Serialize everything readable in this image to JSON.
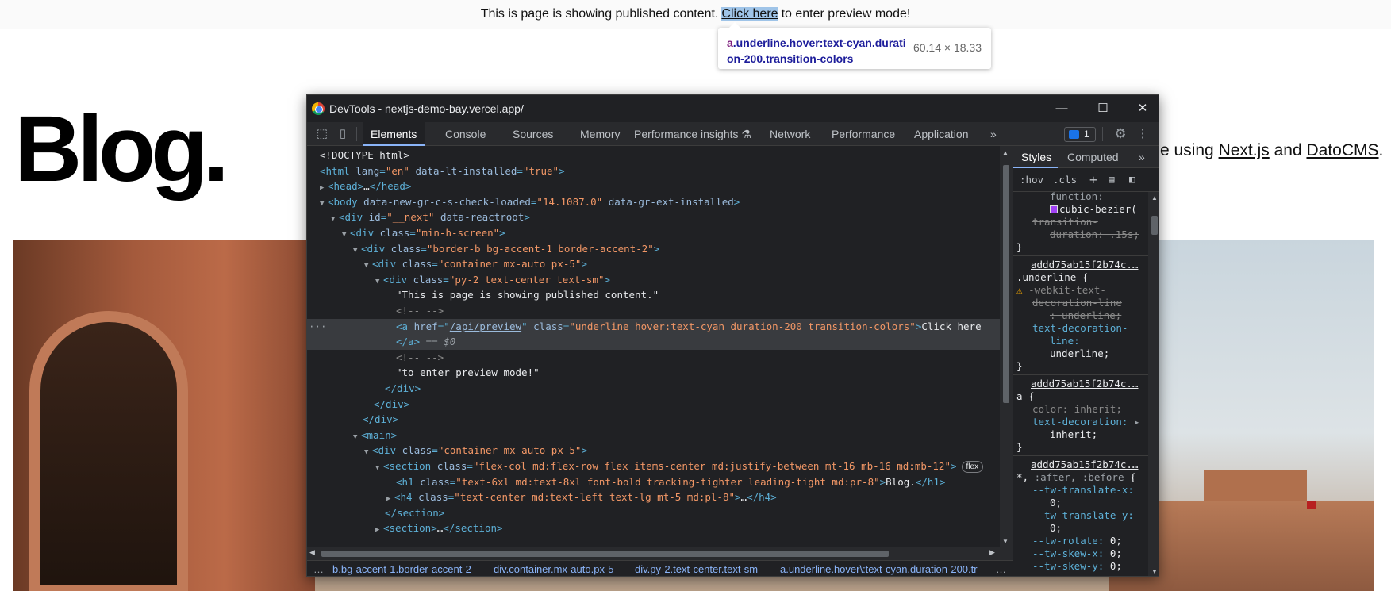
{
  "banner": {
    "text_before": "This is page is showing published content.",
    "link": "Click here",
    "text_after": "to enter preview mode!"
  },
  "tooltip": {
    "tag": "a",
    "classes": ".underline.hover:text-cyan.duration-200.transition-colors",
    "size": "60.14 × 18.33"
  },
  "blog": {
    "title": "Blog.",
    "subtitle_prefix": "e using",
    "link_nextjs": "Next.js",
    "and": "and",
    "link_datocms": "DatoCMS",
    "period": "."
  },
  "devtools": {
    "window_title": "DevTools - nextjs-demo-bay.vercel.app/",
    "win_minimize": "—",
    "win_maximize": "☐",
    "win_close": "✕",
    "tabs": [
      "Elements",
      "Console",
      "Sources",
      "Memory",
      "Performance insights",
      "Network",
      "Performance",
      "Application"
    ],
    "more_tabs": "»",
    "issues_count": "1",
    "dom": {
      "l0": "<!DOCTYPE html>",
      "l1_tag": "html",
      "l1_a1": "lang",
      "l1_v1": "\"en\"",
      "l1_a2": "data-lt-installed",
      "l1_v2": "\"true\"",
      "l2_open": "<head>",
      "l2_ell": "…",
      "l2_close": "</head>",
      "l3_tag": "body",
      "l3_a1": "data-new-gr-c-s-check-loaded",
      "l3_v1": "\"14.1087.0\"",
      "l3_a2": "data-gr-ext-installed",
      "l4_tag": "div",
      "l4_a1": "id",
      "l4_v1": "\"__next\"",
      "l4_a2": "data-reactroot",
      "l5_tag": "div",
      "l5_a1": "class",
      "l5_v1": "\"min-h-screen\"",
      "l6_tag": "div",
      "l6_a1": "class",
      "l6_v1": "\"border-b bg-accent-1 border-accent-2\"",
      "l7_tag": "div",
      "l7_a1": "class",
      "l7_v1": "\"container mx-auto px-5\"",
      "l8_tag": "div",
      "l8_a1": "class",
      "l8_v1": "\"py-2 text-center text-sm\"",
      "l9": "\"This is page is showing published content.\"",
      "l10": "<!-- -->",
      "l11_tag": "a",
      "l11_a1": "href",
      "l11_v1": "/api/preview",
      "l11_a2": "class",
      "l11_v2": "\"underline hover:text-cyan duration-200 transition-colors\"",
      "l11_text": "Click here",
      "l12_close": "</a>",
      "l12_eq": "==",
      "l12_dollar": "$0",
      "l13": "<!-- -->",
      "l14": "\"to enter preview mode!\"",
      "l15": "</div>",
      "l16": "</div>",
      "l17": "</div>",
      "l18": "<main>",
      "l19_tag": "div",
      "l19_a1": "class",
      "l19_v1": "\"container mx-auto px-5\"",
      "l20_tag": "section",
      "l20_a1": "class",
      "l20_v1": "\"flex-col md:flex-row flex items-center md:justify-between mt-16 mb-16 md:mb-12\"",
      "l20_badge": "flex",
      "l21_tag": "h1",
      "l21_a1": "class",
      "l21_v1": "\"text-6xl md:text-8xl font-bold tracking-tighter leading-tight md:pr-8\"",
      "l21_text": "Blog.",
      "l21_close": "</h1>",
      "l22_tag": "h4",
      "l22_a1": "class",
      "l22_v1": "\"text-center md:text-left text-lg mt-5 md:pl-8\"",
      "l22_ell": "…",
      "l22_close": "</h4>",
      "l23": "</section>",
      "l24_open": "<section>",
      "l24_ell": "…",
      "l24_close": "</section>"
    },
    "breadcrumbs": [
      "…",
      "b.bg-accent-1.border-accent-2",
      "div.container.mx-auto.px-5",
      "div.py-2.text-center.text-sm",
      "a.underline.hover\\:text-cyan.duration-200.tr",
      "…"
    ],
    "styles": {
      "tab_styles": "Styles",
      "tab_computed": "Computed",
      "more": "»",
      "hov": ":hov",
      "cls": ".cls",
      "plus": "+",
      "s_fn": "function:",
      "s_cubic": "cubic-bezier(",
      "s_td1": "transition-",
      "s_td2": "duration: .15s;",
      "brace": "}",
      "src1": "addd75ab15f2b74c.…",
      "rule1": ".underline {",
      "r1_p1": "-webkit-text-",
      "r1_p2": "decoration-line",
      "r1_p3": ": underline;",
      "r1_q1": "text-decoration-",
      "r1_q2": "line:",
      "r1_q3": "underline;",
      "src2": "addd75ab15f2b74c.…",
      "rule2": "a {",
      "r2_p1": "color: inherit;",
      "r2_q1": "text-decoration:",
      "r2_q2": "inherit;",
      "src3": "addd75ab15f2b74c.…",
      "rule3_a": "*,",
      "rule3_b": ":after, :before",
      "rule3_c": "{",
      "r3_1": "--tw-translate-x:",
      "r3_1v": "0;",
      "r3_2": "--tw-translate-y:",
      "r3_2v": "0;",
      "r3_3": "--tw-rotate:",
      "r3_3v": "0;",
      "r3_4": "--tw-skew-x:",
      "r3_4v": "0;",
      "r3_5": "--tw-skew-y:",
      "r3_5v": "0;"
    }
  }
}
